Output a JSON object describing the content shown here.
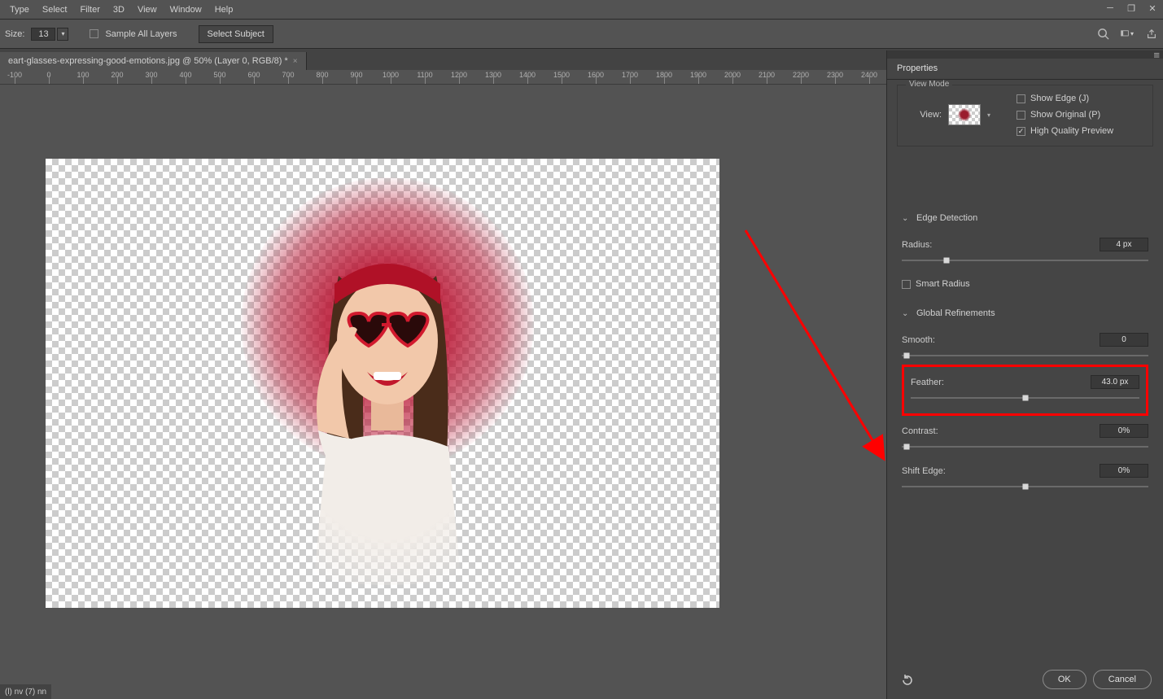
{
  "menu": [
    "Type",
    "Select",
    "Filter",
    "3D",
    "View",
    "Window",
    "Help"
  ],
  "options": {
    "size_label": "Size:",
    "size_value": "13",
    "sample_all_layers": "Sample All Layers",
    "select_subject": "Select Subject"
  },
  "document": {
    "tab_label": "eart-glasses-expressing-good-emotions.jpg @ 50% (Layer 0, RGB/8) *"
  },
  "ruler": {
    "start": -100,
    "end": 2400,
    "step": 100
  },
  "properties": {
    "panel_title": "Properties",
    "view_mode": {
      "title": "View Mode",
      "view_label": "View:",
      "show_edge": "Show Edge (J)",
      "show_original": "Show Original (P)",
      "hq_preview": "High Quality Preview",
      "hq_checked": true
    },
    "edge_detection": {
      "title": "Edge Detection",
      "radius_label": "Radius:",
      "radius_value": "4 px",
      "radius_pct": 18,
      "smart_radius": "Smart Radius"
    },
    "global": {
      "title": "Global Refinements",
      "smooth": {
        "label": "Smooth:",
        "value": "0",
        "pct": 0
      },
      "feather": {
        "label": "Feather:",
        "value": "43.0 px",
        "pct": 50
      },
      "contrast": {
        "label": "Contrast:",
        "value": "0%",
        "pct": 0
      },
      "shift_edge": {
        "label": "Shift Edge:",
        "value": "0%",
        "pct": 50
      }
    }
  },
  "buttons": {
    "ok": "OK",
    "cancel": "Cancel"
  },
  "scrap": "(l) nv (7) nn"
}
